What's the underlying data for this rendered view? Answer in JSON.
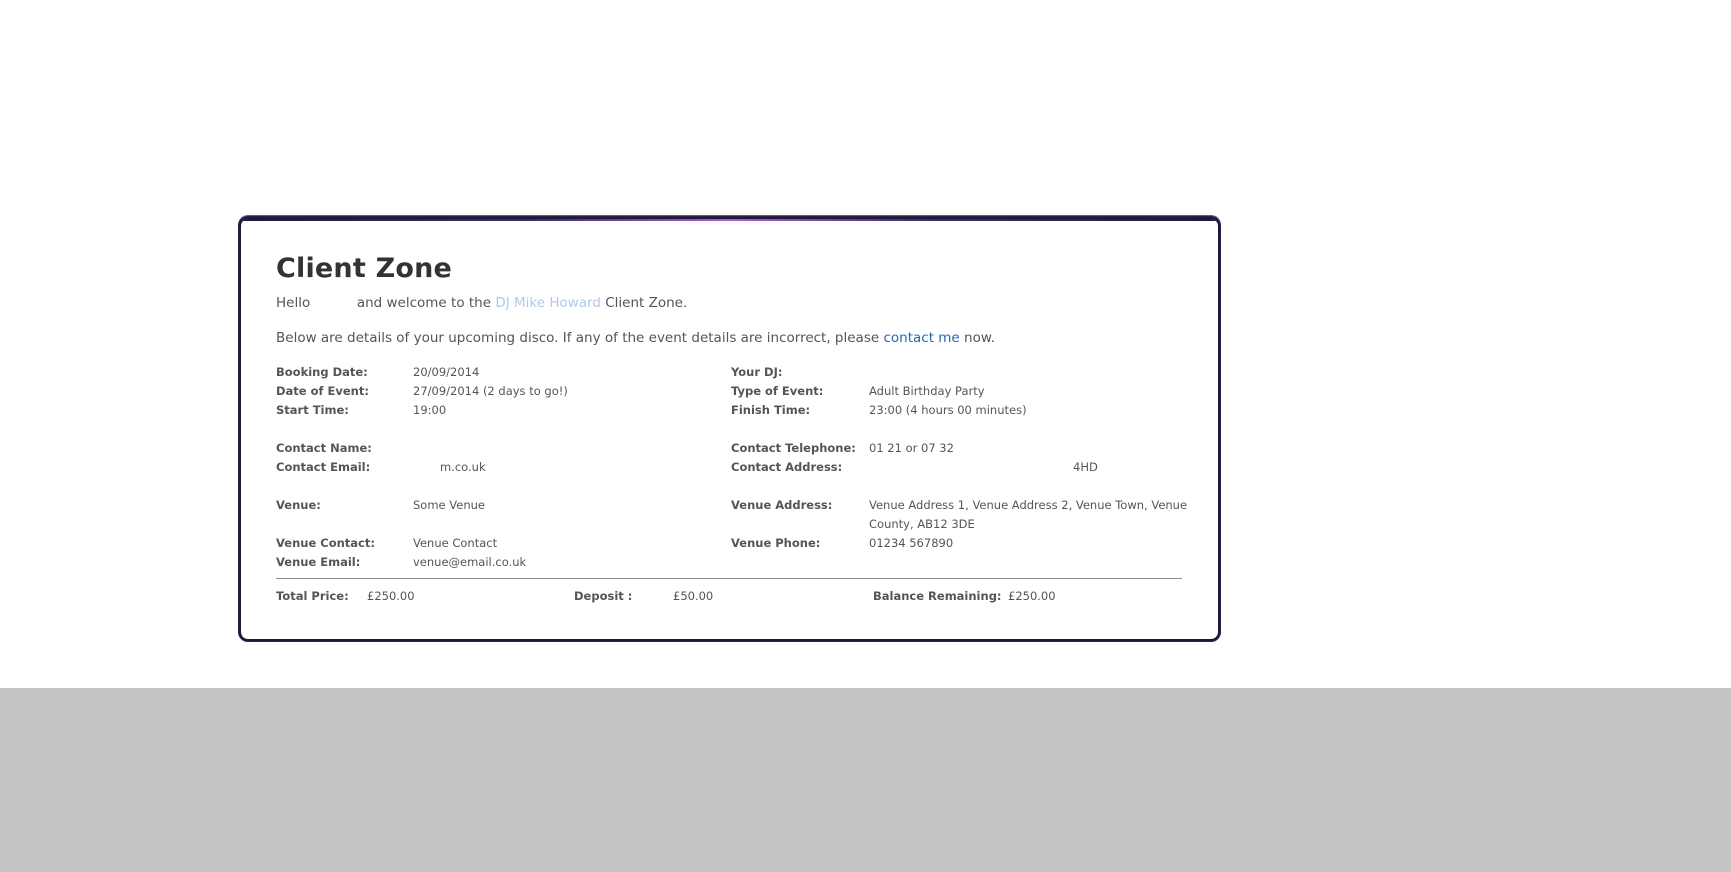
{
  "page": {
    "title": "Client Zone",
    "intro": {
      "hello": "Hello",
      "welcome": "and welcome to the",
      "dj_name": "DJ Mike Howard",
      "client_zone": "Client Zone.",
      "details_prefix": "Below are details of your upcoming disco. If any of the event details are incorrect, please",
      "contact_link": "contact me",
      "details_suffix": "now."
    }
  },
  "booking": {
    "booking_date_label": "Booking Date:",
    "booking_date": "20/09/2014",
    "date_of_event_label": "Date of Event:",
    "date_of_event": "27/09/2014 (2 days to go!)",
    "start_time_label": "Start Time:",
    "start_time": "19:00",
    "your_dj_label": "Your DJ:",
    "your_dj": "",
    "type_of_event_label": "Type of Event:",
    "type_of_event": "Adult Birthday Party",
    "finish_time_label": "Finish Time:",
    "finish_time": "23:00 (4 hours 00 minutes)"
  },
  "contact": {
    "name_label": "Contact Name:",
    "name": "",
    "email_label": "Contact Email:",
    "email": "m.co.uk",
    "telephone_label": "Contact Telephone:",
    "telephone": "01 21 or 07 32",
    "address_label": "Contact Address:",
    "address": "4HD"
  },
  "venue": {
    "venue_label": "Venue:",
    "venue": "Some Venue",
    "address_label": "Venue Address:",
    "address": "Venue Address 1, Venue Address 2, Venue Town, Venue County, AB12 3DE",
    "contact_label": "Venue Contact:",
    "contact": "Venue Contact",
    "phone_label": "Venue Phone:",
    "phone": "01234 567890",
    "email_label": "Venue Email:",
    "email": "venue@email.co.uk"
  },
  "totals": {
    "total_price_label": "Total Price:",
    "total_price": "£250.00",
    "deposit_label": "Deposit :",
    "deposit": "£50.00",
    "balance_label": "Balance Remaining:",
    "balance": "£250.00"
  },
  "colors": {
    "link": "#2266bb",
    "panel_border": "#1e1938",
    "panel_glow": "#b05bd6",
    "footer_band": "#c4c4c4"
  }
}
